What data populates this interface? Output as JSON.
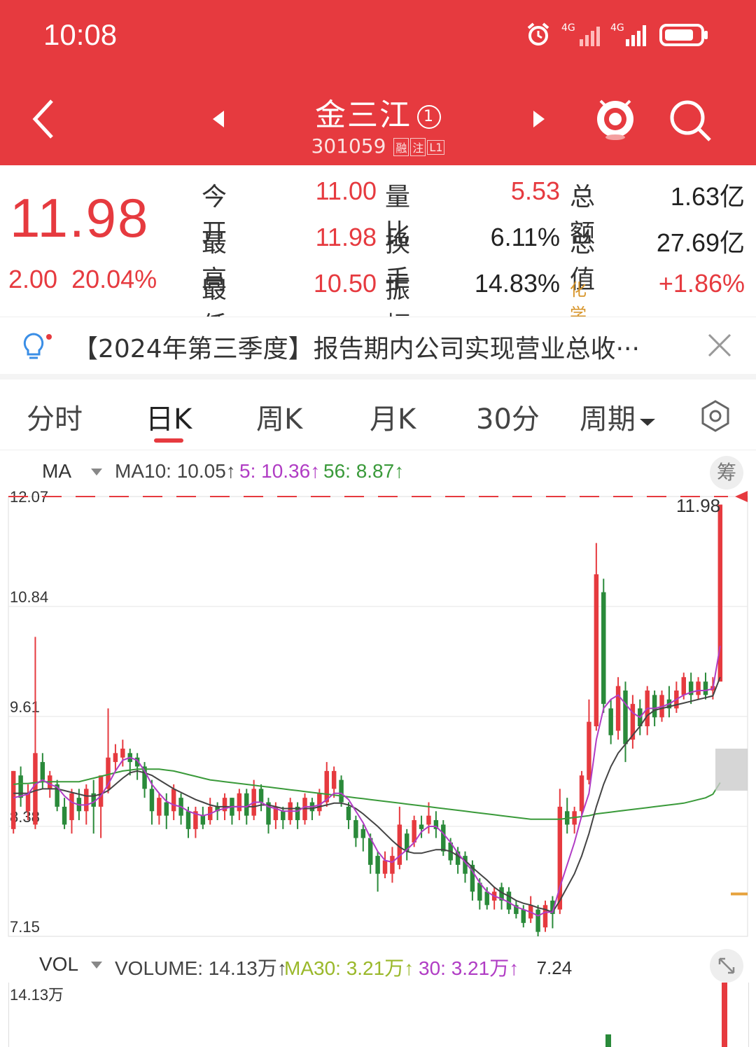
{
  "status_bar": {
    "time": "10:08"
  },
  "header": {
    "stock_name": "金三江",
    "badge_number": "1",
    "stock_code": "301059",
    "tags": [
      "融",
      "注",
      "L1"
    ]
  },
  "quote": {
    "price": "11.98",
    "change": "2.00",
    "change_pct": "20.04%",
    "rows": [
      {
        "l1": "今开",
        "v1": "11.00",
        "l2": "量比",
        "v2": "5.53",
        "l3": "总额",
        "v3": "1.63亿"
      },
      {
        "l1": "最高",
        "v1": "11.98",
        "l2": "换手",
        "v2": "6.11%",
        "l3": "总值",
        "v3": "27.69亿"
      },
      {
        "l1": "最低",
        "v1": "10.50",
        "l2": "振幅",
        "v2": "14.83%",
        "l3": "化学原料",
        "v3": "+1.86%"
      }
    ]
  },
  "notice": {
    "text": "【2024年第三季度】报告期内公司实现营业总收···"
  },
  "tabs": [
    "分时",
    "日K",
    "周K",
    "月K",
    "30分",
    "周期"
  ],
  "active_tab": "日K",
  "ma_legend": {
    "label": "MA",
    "ma10": "MA10: 10.05↑",
    "ma5": "5: 10.36↑",
    "ma56": "56: 8.87↑",
    "chip": "筹"
  },
  "vol_legend": {
    "label": "VOL",
    "volume": "VOLUME: 14.13万↑",
    "ma30": "MA30: 3.21万↑",
    "v30": "30: 3.21万↑",
    "top_label": "14.13万"
  },
  "colors": {
    "up": "#e63a3f",
    "down": "#2a8a3a",
    "ma5": "#b03cc4",
    "ma10": "#444444",
    "ma56": "#3a9a3a",
    "header_bg": "#e63a3f"
  },
  "chart_data": {
    "type": "candlestick",
    "y_ticks": [
      "12.07",
      "10.84",
      "9.61",
      "8.38",
      "7.15"
    ],
    "ylim": [
      7.15,
      12.07
    ],
    "high_label": "11.98",
    "low_label": "7.24",
    "last_close": 11.98,
    "candles": [
      {
        "o": 8.35,
        "c": 9.0,
        "h": 9.0,
        "l": 8.3
      },
      {
        "o": 8.95,
        "c": 8.7,
        "h": 9.05,
        "l": 8.6
      },
      {
        "o": 8.55,
        "c": 8.75,
        "h": 8.85,
        "l": 8.45
      },
      {
        "o": 8.4,
        "c": 9.2,
        "h": 10.5,
        "l": 8.35
      },
      {
        "o": 9.1,
        "c": 8.9,
        "h": 9.2,
        "l": 8.8
      },
      {
        "o": 8.8,
        "c": 8.95,
        "h": 9.0,
        "l": 8.7
      },
      {
        "o": 8.85,
        "c": 8.6,
        "h": 8.9,
        "l": 8.55
      },
      {
        "o": 8.6,
        "c": 8.4,
        "h": 8.7,
        "l": 8.35
      },
      {
        "o": 8.45,
        "c": 8.75,
        "h": 8.8,
        "l": 8.3
      },
      {
        "o": 8.7,
        "c": 8.55,
        "h": 8.8,
        "l": 8.45
      },
      {
        "o": 8.55,
        "c": 8.8,
        "h": 8.85,
        "l": 8.4
      },
      {
        "o": 8.75,
        "c": 8.6,
        "h": 8.9,
        "l": 8.3
      },
      {
        "o": 8.6,
        "c": 8.95,
        "h": 8.95,
        "l": 8.25
      },
      {
        "o": 8.8,
        "c": 9.15,
        "h": 9.7,
        "l": 8.75
      },
      {
        "o": 9.1,
        "c": 9.2,
        "h": 9.3,
        "l": 9.0
      },
      {
        "o": 9.15,
        "c": 9.25,
        "h": 9.35,
        "l": 9.05
      },
      {
        "o": 9.2,
        "c": 9.1,
        "h": 9.25,
        "l": 8.95
      },
      {
        "o": 9.15,
        "c": 9.05,
        "h": 9.2,
        "l": 8.9
      },
      {
        "o": 9.05,
        "c": 8.8,
        "h": 9.1,
        "l": 8.7
      },
      {
        "o": 8.8,
        "c": 8.55,
        "h": 8.9,
        "l": 8.4
      },
      {
        "o": 8.5,
        "c": 8.7,
        "h": 8.75,
        "l": 8.4
      },
      {
        "o": 8.65,
        "c": 8.5,
        "h": 8.75,
        "l": 8.35
      },
      {
        "o": 8.55,
        "c": 8.8,
        "h": 8.85,
        "l": 8.45
      },
      {
        "o": 8.7,
        "c": 8.5,
        "h": 8.75,
        "l": 8.4
      },
      {
        "o": 8.55,
        "c": 8.35,
        "h": 8.6,
        "l": 8.25
      },
      {
        "o": 8.35,
        "c": 8.55,
        "h": 8.6,
        "l": 8.25
      },
      {
        "o": 8.5,
        "c": 8.4,
        "h": 8.6,
        "l": 8.35
      },
      {
        "o": 8.45,
        "c": 8.6,
        "h": 8.7,
        "l": 8.4
      },
      {
        "o": 8.6,
        "c": 8.55,
        "h": 8.65,
        "l": 8.45
      },
      {
        "o": 8.55,
        "c": 8.7,
        "h": 8.75,
        "l": 8.45
      },
      {
        "o": 8.7,
        "c": 8.5,
        "h": 8.7,
        "l": 8.4
      },
      {
        "o": 8.55,
        "c": 8.75,
        "h": 8.8,
        "l": 8.45
      },
      {
        "o": 8.75,
        "c": 8.5,
        "h": 8.8,
        "l": 8.4
      },
      {
        "o": 8.5,
        "c": 8.8,
        "h": 8.9,
        "l": 8.45
      },
      {
        "o": 8.8,
        "c": 8.65,
        "h": 8.85,
        "l": 8.55
      },
      {
        "o": 8.65,
        "c": 8.4,
        "h": 8.7,
        "l": 8.3
      },
      {
        "o": 8.45,
        "c": 8.6,
        "h": 8.65,
        "l": 8.35
      },
      {
        "o": 8.55,
        "c": 8.45,
        "h": 8.6,
        "l": 8.35
      },
      {
        "o": 8.45,
        "c": 8.65,
        "h": 8.7,
        "l": 8.4
      },
      {
        "o": 8.6,
        "c": 8.45,
        "h": 8.65,
        "l": 8.35
      },
      {
        "o": 8.45,
        "c": 8.7,
        "h": 8.75,
        "l": 8.4
      },
      {
        "o": 8.65,
        "c": 8.55,
        "h": 8.7,
        "l": 8.45
      },
      {
        "o": 8.55,
        "c": 8.75,
        "h": 8.8,
        "l": 8.5
      },
      {
        "o": 8.65,
        "c": 9.0,
        "h": 9.1,
        "l": 8.6
      },
      {
        "o": 8.8,
        "c": 9.0,
        "h": 9.05,
        "l": 8.7
      },
      {
        "o": 8.9,
        "c": 8.65,
        "h": 8.95,
        "l": 8.6
      },
      {
        "o": 8.6,
        "c": 8.45,
        "h": 8.65,
        "l": 8.35
      },
      {
        "o": 8.45,
        "c": 8.25,
        "h": 8.5,
        "l": 8.15
      },
      {
        "o": 8.35,
        "c": 8.25,
        "h": 8.4,
        "l": 8.1
      },
      {
        "o": 8.25,
        "c": 7.95,
        "h": 8.3,
        "l": 7.85
      },
      {
        "o": 8.05,
        "c": 7.85,
        "h": 8.1,
        "l": 7.65
      },
      {
        "o": 7.85,
        "c": 8.0,
        "h": 8.1,
        "l": 7.8
      },
      {
        "o": 7.85,
        "c": 8.05,
        "h": 8.15,
        "l": 7.75
      },
      {
        "o": 7.95,
        "c": 8.4,
        "h": 8.6,
        "l": 7.9
      },
      {
        "o": 8.3,
        "c": 8.1,
        "h": 8.35,
        "l": 8.0
      },
      {
        "o": 8.2,
        "c": 8.45,
        "h": 8.5,
        "l": 8.15
      },
      {
        "o": 8.4,
        "c": 8.35,
        "h": 8.5,
        "l": 8.25
      },
      {
        "o": 8.4,
        "c": 8.5,
        "h": 8.65,
        "l": 8.3
      },
      {
        "o": 8.45,
        "c": 8.35,
        "h": 8.55,
        "l": 8.25
      },
      {
        "o": 8.4,
        "c": 8.1,
        "h": 8.45,
        "l": 8.05
      },
      {
        "o": 8.2,
        "c": 8.0,
        "h": 8.25,
        "l": 7.95
      },
      {
        "o": 8.1,
        "c": 7.95,
        "h": 8.15,
        "l": 7.85
      },
      {
        "o": 8.05,
        "c": 7.85,
        "h": 8.1,
        "l": 7.75
      },
      {
        "o": 7.95,
        "c": 7.65,
        "h": 8.0,
        "l": 7.55
      },
      {
        "o": 7.75,
        "c": 7.55,
        "h": 7.8,
        "l": 7.45
      },
      {
        "o": 7.65,
        "c": 7.5,
        "h": 7.7,
        "l": 7.45
      },
      {
        "o": 7.55,
        "c": 7.65,
        "h": 7.7,
        "l": 7.45
      },
      {
        "o": 7.7,
        "c": 7.55,
        "h": 7.75,
        "l": 7.45
      },
      {
        "o": 7.65,
        "c": 7.45,
        "h": 7.7,
        "l": 7.4
      },
      {
        "o": 7.5,
        "c": 7.4,
        "h": 7.55,
        "l": 7.35
      },
      {
        "o": 7.45,
        "c": 7.3,
        "h": 7.5,
        "l": 7.25
      },
      {
        "o": 7.35,
        "c": 7.5,
        "h": 7.6,
        "l": 7.3
      },
      {
        "o": 7.45,
        "c": 7.2,
        "h": 7.5,
        "l": 7.15
      },
      {
        "o": 7.25,
        "c": 7.5,
        "h": 7.55,
        "l": 7.2
      },
      {
        "o": 7.55,
        "c": 7.4,
        "h": 7.6,
        "l": 7.24
      },
      {
        "o": 7.45,
        "c": 8.6,
        "h": 8.8,
        "l": 7.4
      },
      {
        "o": 8.55,
        "c": 8.4,
        "h": 8.7,
        "l": 8.3
      },
      {
        "o": 8.4,
        "c": 8.55,
        "h": 8.6,
        "l": 8.3
      },
      {
        "o": 8.55,
        "c": 8.95,
        "h": 9.0,
        "l": 8.5
      },
      {
        "o": 8.9,
        "c": 9.55,
        "h": 9.8,
        "l": 8.85
      },
      {
        "o": 9.5,
        "c": 11.2,
        "h": 11.55,
        "l": 9.45
      },
      {
        "o": 11.0,
        "c": 9.75,
        "h": 11.15,
        "l": 9.65
      },
      {
        "o": 9.7,
        "c": 9.4,
        "h": 9.8,
        "l": 9.3
      },
      {
        "o": 9.45,
        "c": 9.95,
        "h": 10.05,
        "l": 9.35
      },
      {
        "o": 9.9,
        "c": 9.3,
        "h": 10.0,
        "l": 9.1
      },
      {
        "o": 9.35,
        "c": 9.75,
        "h": 9.85,
        "l": 9.25
      },
      {
        "o": 9.7,
        "c": 9.5,
        "h": 9.8,
        "l": 9.4
      },
      {
        "o": 9.5,
        "c": 9.9,
        "h": 9.95,
        "l": 9.4
      },
      {
        "o": 9.85,
        "c": 9.6,
        "h": 9.9,
        "l": 9.5
      },
      {
        "o": 9.6,
        "c": 9.85,
        "h": 9.9,
        "l": 9.55
      },
      {
        "o": 9.8,
        "c": 9.7,
        "h": 9.95,
        "l": 9.6
      },
      {
        "o": 9.7,
        "c": 9.9,
        "h": 10.0,
        "l": 9.65
      },
      {
        "o": 9.85,
        "c": 10.05,
        "h": 10.1,
        "l": 9.8
      },
      {
        "o": 10.0,
        "c": 9.85,
        "h": 10.1,
        "l": 9.75
      },
      {
        "o": 9.85,
        "c": 10.0,
        "h": 10.05,
        "l": 9.8
      },
      {
        "o": 10.0,
        "c": 9.85,
        "h": 10.1,
        "l": 9.8
      },
      {
        "o": 9.9,
        "c": 9.95,
        "h": 10.05,
        "l": 9.8
      },
      {
        "o": 10.0,
        "c": 11.98,
        "h": 11.98,
        "l": 10.5
      }
    ],
    "ma5": [
      8.7,
      8.72,
      8.74,
      8.85,
      8.9,
      8.85,
      8.82,
      8.72,
      8.65,
      8.62,
      8.62,
      8.65,
      8.72,
      8.85,
      9.0,
      9.12,
      9.15,
      9.12,
      9.0,
      8.85,
      8.75,
      8.66,
      8.62,
      8.6,
      8.55,
      8.52,
      8.5,
      8.52,
      8.56,
      8.58,
      8.6,
      8.6,
      8.6,
      8.65,
      8.65,
      8.6,
      8.58,
      8.55,
      8.55,
      8.55,
      8.6,
      8.6,
      8.62,
      8.68,
      8.75,
      8.75,
      8.68,
      8.55,
      8.42,
      8.25,
      8.1,
      8.0,
      7.98,
      8.05,
      8.12,
      8.2,
      8.32,
      8.38,
      8.38,
      8.3,
      8.2,
      8.08,
      7.98,
      7.88,
      7.75,
      7.65,
      7.6,
      7.57,
      7.53,
      7.48,
      7.45,
      7.42,
      7.38,
      7.42,
      7.42,
      7.7,
      7.95,
      8.2,
      8.5,
      8.75,
      9.35,
      9.7,
      9.8,
      9.85,
      9.75,
      9.65,
      9.6,
      9.7,
      9.7,
      9.72,
      9.75,
      9.8,
      9.85,
      9.88,
      9.9,
      9.9,
      9.92,
      10.4
    ],
    "ma10": [
      8.75,
      8.75,
      8.75,
      8.78,
      8.8,
      8.8,
      8.8,
      8.78,
      8.76,
      8.74,
      8.72,
      8.72,
      8.74,
      8.78,
      8.85,
      8.92,
      8.98,
      9.0,
      8.98,
      8.95,
      8.9,
      8.85,
      8.8,
      8.76,
      8.72,
      8.68,
      8.65,
      8.62,
      8.6,
      8.6,
      8.6,
      8.6,
      8.6,
      8.6,
      8.62,
      8.62,
      8.6,
      8.58,
      8.58,
      8.58,
      8.58,
      8.58,
      8.6,
      8.62,
      8.64,
      8.64,
      8.62,
      8.58,
      8.52,
      8.45,
      8.38,
      8.3,
      8.22,
      8.15,
      8.1,
      8.08,
      8.08,
      8.1,
      8.12,
      8.12,
      8.1,
      8.05,
      8.0,
      7.92,
      7.85,
      7.78,
      7.7,
      7.64,
      7.6,
      7.55,
      7.52,
      7.5,
      7.47,
      7.45,
      7.42,
      7.55,
      7.7,
      7.85,
      8.05,
      8.3,
      8.6,
      8.85,
      9.05,
      9.2,
      9.3,
      9.4,
      9.5,
      9.62,
      9.68,
      9.7,
      9.72,
      9.74,
      9.76,
      9.78,
      9.8,
      9.82,
      9.84,
      10.05
    ],
    "ma56": [
      8.85,
      8.86,
      8.86,
      8.87,
      8.88,
      8.88,
      8.88,
      8.88,
      8.88,
      8.88,
      8.9,
      8.92,
      8.94,
      8.96,
      8.98,
      9.0,
      9.01,
      9.02,
      9.02,
      9.02,
      9.02,
      9.01,
      9.0,
      8.98,
      8.96,
      8.94,
      8.92,
      8.9,
      8.89,
      8.88,
      8.87,
      8.86,
      8.85,
      8.84,
      8.83,
      8.82,
      8.81,
      8.8,
      8.79,
      8.78,
      8.77,
      8.76,
      8.75,
      8.74,
      8.73,
      8.72,
      8.71,
      8.7,
      8.69,
      8.68,
      8.67,
      8.66,
      8.65,
      8.64,
      8.63,
      8.62,
      8.61,
      8.6,
      8.59,
      8.58,
      8.57,
      8.56,
      8.55,
      8.54,
      8.53,
      8.52,
      8.51,
      8.5,
      8.49,
      8.48,
      8.47,
      8.46,
      8.46,
      8.46,
      8.46,
      8.46,
      8.47,
      8.48,
      8.49,
      8.5,
      8.52,
      8.53,
      8.54,
      8.55,
      8.56,
      8.57,
      8.58,
      8.59,
      8.6,
      8.61,
      8.62,
      8.63,
      8.64,
      8.66,
      8.68,
      8.7,
      8.74,
      8.87
    ],
    "volume": {
      "last": "14.13万"
    }
  }
}
